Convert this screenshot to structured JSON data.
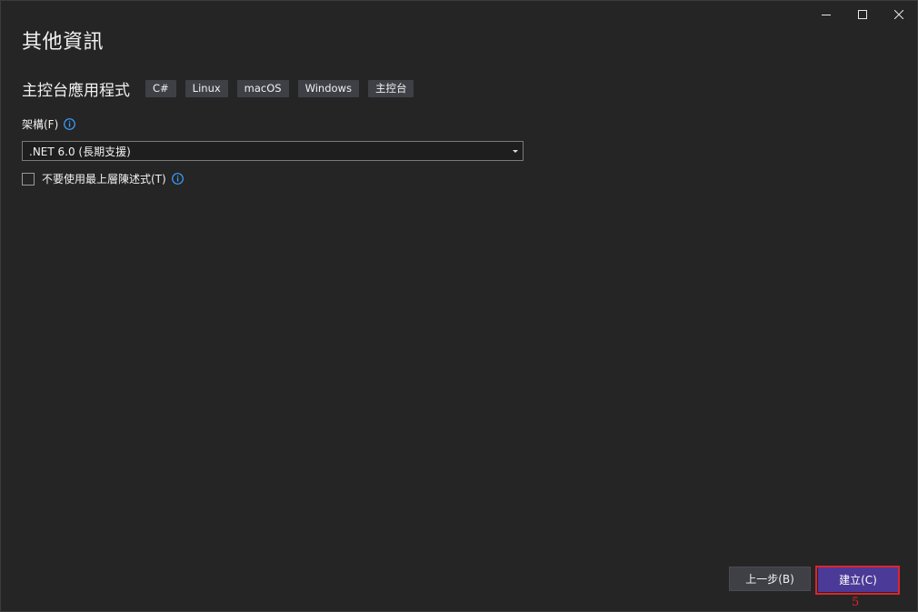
{
  "window": {
    "controls": {
      "minimize_icon": "minimize-icon",
      "maximize_icon": "maximize-icon",
      "close_icon": "close-icon"
    }
  },
  "page": {
    "title": "其他資訊"
  },
  "project": {
    "name": "主控台應用程式",
    "tags": [
      "C#",
      "Linux",
      "macOS",
      "Windows",
      "主控台"
    ]
  },
  "framework": {
    "label": "架構(F)",
    "info_icon": "info-icon",
    "selected_value": ".NET 6.0 (長期支援)"
  },
  "top_level_statements": {
    "label": "不要使用最上層陳述式(T)",
    "checked": false,
    "info_icon": "info-icon"
  },
  "footer": {
    "back_label": "上一步(B)",
    "create_label": "建立(C)",
    "step_marker": "5"
  },
  "colors": {
    "background": "#252526",
    "accent": "#4b3a97",
    "highlight": "#e0242b",
    "info": "#3aa0ff"
  }
}
